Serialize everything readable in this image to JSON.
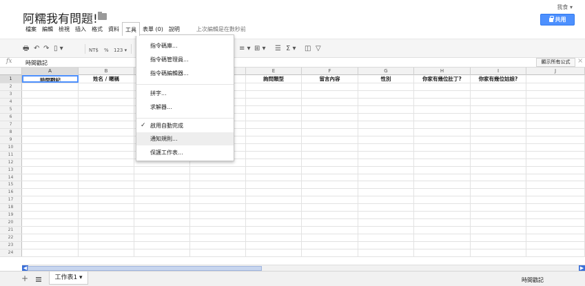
{
  "doc": {
    "title": "阿糯我有問題!",
    "star": "☆",
    "user": "我食 ▾",
    "share_label": "共用"
  },
  "menubar": {
    "items": [
      "檔案",
      "編輯",
      "檢視",
      "插入",
      "格式",
      "資料",
      "工具",
      "表單 (0)",
      "說明"
    ],
    "last_edit": "上次編輯是在數秒前"
  },
  "toolbar": {
    "print": "🖶",
    "undo": "↶",
    "redo": "↷",
    "paint": "▯ ▾",
    "currency": "NT$",
    "percent": "%",
    "number_format": "123 ▾",
    "align": "≡ ▾",
    "merge": "⊞ ▾",
    "wrap": "☰",
    "sum": "Σ ▾",
    "chart": "◫",
    "filter": "▽"
  },
  "formula_bar": {
    "fx": "fx",
    "value": "時間戳記",
    "show_all_formula": "顯示所有公式",
    "close": "×"
  },
  "grid": {
    "columns": [
      "A",
      "B",
      "C",
      "D",
      "E",
      "F",
      "G",
      "H",
      "I",
      "J"
    ],
    "header_row": [
      "時間戳記",
      "姓名 / 暱稱",
      "",
      "",
      "詢問類型",
      "留言內容",
      "性別",
      "你家有幾位肚丁?",
      "你家有幾位姑娘?",
      ""
    ],
    "row_numbers": [
      "1",
      "2",
      "3",
      "4",
      "5",
      "6",
      "7",
      "8",
      "9",
      "10",
      "11",
      "12",
      "13",
      "14",
      "15",
      "16",
      "17",
      "18",
      "19",
      "20",
      "21",
      "22",
      "23",
      "24"
    ]
  },
  "tools_menu": {
    "items": [
      {
        "label": "指令碼庫..."
      },
      {
        "label": "指令碼管理員..."
      },
      {
        "label": "指令碼編輯器..."
      },
      {
        "label": "拼字..."
      },
      {
        "label": "求解器..."
      },
      {
        "label": "啟用自動完成",
        "checked": "✓"
      },
      {
        "label": "通知規則..."
      },
      {
        "label": "保護工作表..."
      }
    ]
  },
  "bottom": {
    "add": "+",
    "sheet_tab": "工作表1 ▾",
    "status": "時間戳記",
    "scroll_left": "◀",
    "scroll_right": "▶"
  }
}
